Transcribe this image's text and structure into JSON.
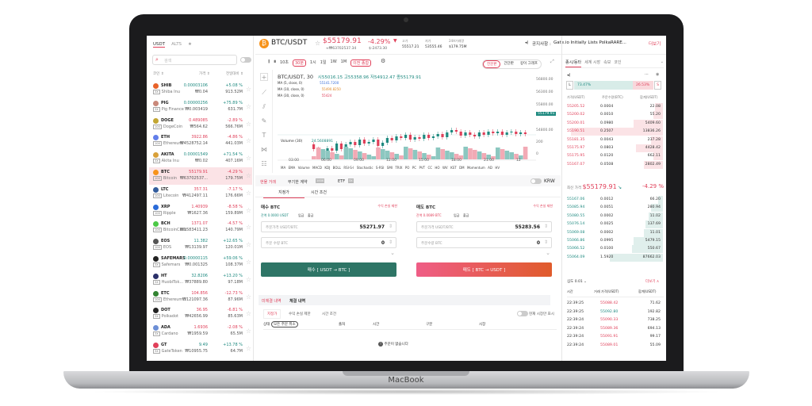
{
  "device": {
    "brand": "MacBook"
  },
  "markets": {
    "tabs": [
      "USDT",
      "ALTS"
    ],
    "search_placeholder": "검색",
    "columns": [
      "코인 ⇕",
      "가격 ⇕",
      "전일대비 ⇕"
    ],
    "coins": [
      {
        "sym": "SHIB",
        "name": "Shiba Inu",
        "lev": "3X",
        "price": "0.00003106",
        "krw": "₩0.04",
        "change": "+5.08 %",
        "vol": "913.52M",
        "up": true,
        "color": "#e8622a"
      },
      {
        "sym": "PIG",
        "name": "Pig Finance",
        "lev": "3X",
        "price": "0.00000256",
        "krw": "₩0.003419",
        "change": "+75.89 %",
        "vol": "631.7M",
        "up": true,
        "color": "#c9887a"
      },
      {
        "sym": "DOGE",
        "name": "DogeCoin",
        "lev": "10X",
        "price": "0.489085",
        "krw": "₩564.62",
        "change": "-2.89 %",
        "vol": "566.76M",
        "up": false,
        "color": "#c2a633"
      },
      {
        "sym": "ETH",
        "name": "Ethereum",
        "lev": "10X",
        "price": "3922.86",
        "krw": "₩4528752.14",
        "change": "-4.86 %",
        "vol": "441.03M",
        "up": false,
        "color": "#627eea"
      },
      {
        "sym": "AKITA",
        "name": "Akita Inu",
        "lev": "3X",
        "price": "0.00001549",
        "krw": "₩0.02",
        "change": "+71.54 %",
        "vol": "407.16M",
        "up": true,
        "color": "#d9a13b"
      },
      {
        "sym": "BTC",
        "name": "Bitcoin",
        "lev": "10X",
        "price": "55179.91",
        "krw": "₩63702537...",
        "change": "-4.29 %",
        "vol": "179.75M",
        "up": false,
        "color": "#f7931a"
      },
      {
        "sym": "LTC",
        "name": "Litecoin",
        "lev": "10X",
        "price": "357.31",
        "krw": "₩412497.11",
        "change": "-7.17 %",
        "vol": "176.66M",
        "up": false,
        "color": "#345d9d"
      },
      {
        "sym": "XRP",
        "name": "Ripple",
        "lev": "10X",
        "price": "1.40939",
        "krw": "₩1627.36",
        "change": "-8.58 %",
        "vol": "159.89M",
        "up": false,
        "color": "#2a6bd8"
      },
      {
        "sym": "BCH",
        "name": "BitcoinCash",
        "lev": "10X",
        "price": "1371.07",
        "krw": "₩1583411.23",
        "change": "-4.57 %",
        "vol": "140.79M",
        "up": false,
        "color": "#4cc947"
      },
      {
        "sym": "EOS",
        "name": "EOS",
        "lev": "10X",
        "price": "11.382",
        "krw": "₩13139.97",
        "change": "+12.65 %",
        "vol": "120.01M",
        "up": true,
        "color": "#555"
      },
      {
        "sym": "SAFEMARS",
        "name": "Safemars",
        "lev": "3X",
        "price": "0.00000115",
        "krw": "₩0.001325",
        "change": "+59.06 %",
        "vol": "108.37M",
        "up": true,
        "color": "#222"
      },
      {
        "sym": "HT",
        "name": "HuobiTok...",
        "lev": "3X",
        "price": "32.8206",
        "krw": "₩37889.80",
        "change": "+13.20 %",
        "vol": "97.18M",
        "up": true,
        "color": "#2a3069"
      },
      {
        "sym": "ETC",
        "name": "Ethereum...",
        "lev": "10X",
        "price": "104.856",
        "krw": "₩121097.36",
        "change": "-12.73 %",
        "vol": "87.96M",
        "up": false,
        "color": "#328332"
      },
      {
        "sym": "DOT",
        "name": "Polkadot",
        "lev": "3X",
        "price": "36.95",
        "krw": "₩42656.99",
        "change": "-6.81 %",
        "vol": "85.63M",
        "up": false,
        "color": "#222"
      },
      {
        "sym": "ADA",
        "name": "Cardano",
        "lev": "3X",
        "price": "1.6936",
        "krw": "₩1959.59",
        "change": "-2.08 %",
        "vol": "65.5M",
        "up": false,
        "color": "#6d8fd6"
      },
      {
        "sym": "GT",
        "name": "GateToken",
        "lev": "3X",
        "price": "9.49",
        "krw": "₩10955.75",
        "change": "+13.78 %",
        "vol": "64.7M",
        "up": true,
        "color": "#e0405a"
      }
    ]
  },
  "header": {
    "pair": "BTC/USDT",
    "price": "$55179.91",
    "price_krw": "≈₩63702537.34",
    "change_pct": "-4.29%",
    "change_abs": "$-2473.30",
    "high_label": "고가",
    "high": "55517.21",
    "low_label": "저가",
    "low": "53555.46",
    "vol_label": "24H거래량",
    "vol": "$179.75M",
    "notice_label": "공지사항 :",
    "notice": "Gate.io Initially Lists PolkaRARE...",
    "more": "더보기"
  },
  "chart": {
    "intervals": [
      "10초",
      "30분",
      "1시",
      "1일",
      "1W",
      "1M",
      "이전 종합"
    ],
    "active_interval": "30분",
    "views": [
      "전문판",
      "간단판",
      "깊이 그래프"
    ],
    "legend": {
      "title": "BTC/USDT, 30",
      "ohlc": "시55016.15  고55358.96  저54912.47  종55179.91",
      "ma": [
        {
          "label": "MA (5, close, 0)",
          "value": "55141.7200",
          "color": "#3a6fd8"
        },
        {
          "label": "MA (10, close, 0)",
          "value": "55490.8250",
          "color": "#e08a2a"
        },
        {
          "label": "MA (30, close, 0)",
          "value": "55424",
          "color": "#e0405a"
        }
      ],
      "volume_label": "Volume (30)",
      "volume_value": "24.5608891"
    },
    "y_ticks": [
      "56800.00",
      "56300.00",
      "55800.00",
      "54800.00"
    ],
    "current": "55179.91",
    "vol_ticks": [
      "200",
      "0"
    ],
    "x_ticks": [
      "03:00",
      "06:00",
      "09:00",
      "12:00",
      "15:00",
      "18:00",
      "21:00",
      "12"
    ],
    "indicators": [
      "MA",
      "EMA",
      "Volume",
      "MACD",
      "KDJ",
      "BOLL",
      "RSI-S-I",
      "Stochastic",
      "S-RSI",
      "SMI",
      "TRIX",
      "PO",
      "PC",
      "PVT",
      "CC",
      "HO",
      "WV",
      "KST",
      "DM",
      "Momentum",
      "AD",
      "HV"
    ]
  },
  "trade": {
    "tabs": [
      "현물 거래",
      "무기한 계약",
      "ETF"
    ],
    "badges": [
      "100X",
      "3X"
    ],
    "krw": "KRW",
    "subtabs": [
      "지정가",
      "시간 조건"
    ],
    "buy": {
      "title": "매수 BTC",
      "limit": "수익 손실 제한",
      "balance": "잔액 0.0000 USDT",
      "deposit": "입금",
      "withdraw": "출금",
      "price_label": "주문가격 USDT/BTC",
      "price": "55271.97",
      "qty_label": "주문 수량 BTC",
      "qty": "0",
      "button": "매수 [  USDT  →  BTC  ]"
    },
    "sell": {
      "title": "매도 BTC",
      "limit": "수익 손실 제한",
      "balance": "잔액 0.0089 BTC",
      "deposit": "입금",
      "withdraw": "출금",
      "price_label": "주문가격 USDT/BTC",
      "price": "55283.56",
      "qty_label": "주문수량 BTC",
      "qty": "0",
      "button": "매도 [  BTC  →  USDT  ]"
    }
  },
  "orders": {
    "tabs": [
      "미체결 내역",
      "체결 내역"
    ],
    "subtabs": [
      "지정가",
      "수익 손실 제한",
      "시간 조건"
    ],
    "toggle": "현재 시장만 표시",
    "cols": [
      "상태",
      "출처",
      "시간",
      "구분",
      "시장"
    ],
    "cancel_all": "모든 주문 취소",
    "empty": "주문이 없습니다"
  },
  "book": {
    "tabs": [
      "종시/동타",
      "세계 시장",
      "속보",
      "코인"
    ],
    "long": "73.47%",
    "short": "26.53%",
    "L": "L",
    "S": "S",
    "cols": [
      "가격(USDT)",
      "주문수량(BTC)",
      "합계(USDT)"
    ],
    "asks": [
      [
        "55205.52",
        "0.0004",
        "22.08"
      ],
      [
        "55200.02",
        "0.0010",
        "55.20"
      ],
      [
        "55200.01",
        "0.0980",
        "5409.60"
      ],
      [
        "55190.51",
        "0.2507",
        "13836.26"
      ],
      [
        "55181.35",
        "0.0043",
        "237.28"
      ],
      [
        "55175.97",
        "0.0803",
        "4428.42"
      ],
      [
        "55175.95",
        "0.0120",
        "662.11"
      ],
      [
        "55167.07",
        "0.0508",
        "2802.49"
      ]
    ],
    "ask_depth": [
      0.08,
      0.1,
      0.3,
      0.95,
      0.12,
      0.28,
      0.1,
      0.2
    ],
    "last_label": "최신 가격",
    "last": "$55179.91",
    "last_change": "-4.29 %",
    "bids": [
      [
        "55167.06",
        "0.0012",
        "66.20"
      ],
      [
        "55085.94",
        "0.0051",
        "280.94"
      ],
      [
        "55080.55",
        "0.0002",
        "11.02"
      ],
      [
        "55076.14",
        "0.0025",
        "137.69"
      ],
      [
        "55069.08",
        "0.0002",
        "11.01"
      ],
      [
        "55066.86",
        "0.0995",
        "5479.15"
      ],
      [
        "55066.52",
        "0.0100",
        "550.67"
      ],
      [
        "55064.09",
        "1.5920",
        "87662.03"
      ]
    ],
    "bid_depth": [
      0.05,
      0.12,
      0.15,
      0.18,
      0.2,
      0.3,
      0.32,
      0.55
    ],
    "depth_label": "심도 0.01",
    "more": "더보기 ∧",
    "trade_cols": [
      "시간",
      "거래 가격(USDT)",
      "합계(USDT)"
    ],
    "trades": [
      [
        "22:39:25",
        "55088.42",
        "71.62",
        false
      ],
      [
        "22:39:25",
        "55092.80",
        "192.82",
        true
      ],
      [
        "22:39:24",
        "55090.33",
        "738.25",
        false
      ],
      [
        "22:39:24",
        "55089.36",
        "694.13",
        false
      ],
      [
        "22:39:24",
        "55091.91",
        "99.17",
        false
      ],
      [
        "22:39:24",
        "55089.01",
        "55.09",
        false
      ]
    ]
  },
  "colors": {
    "up": "#1f8a80",
    "down": "#e0405a",
    "buy_button": "#2e7566",
    "sell_button_start": "#ef5d86",
    "sell_button_end": "#e05b2b",
    "brand": "#f7931a"
  }
}
